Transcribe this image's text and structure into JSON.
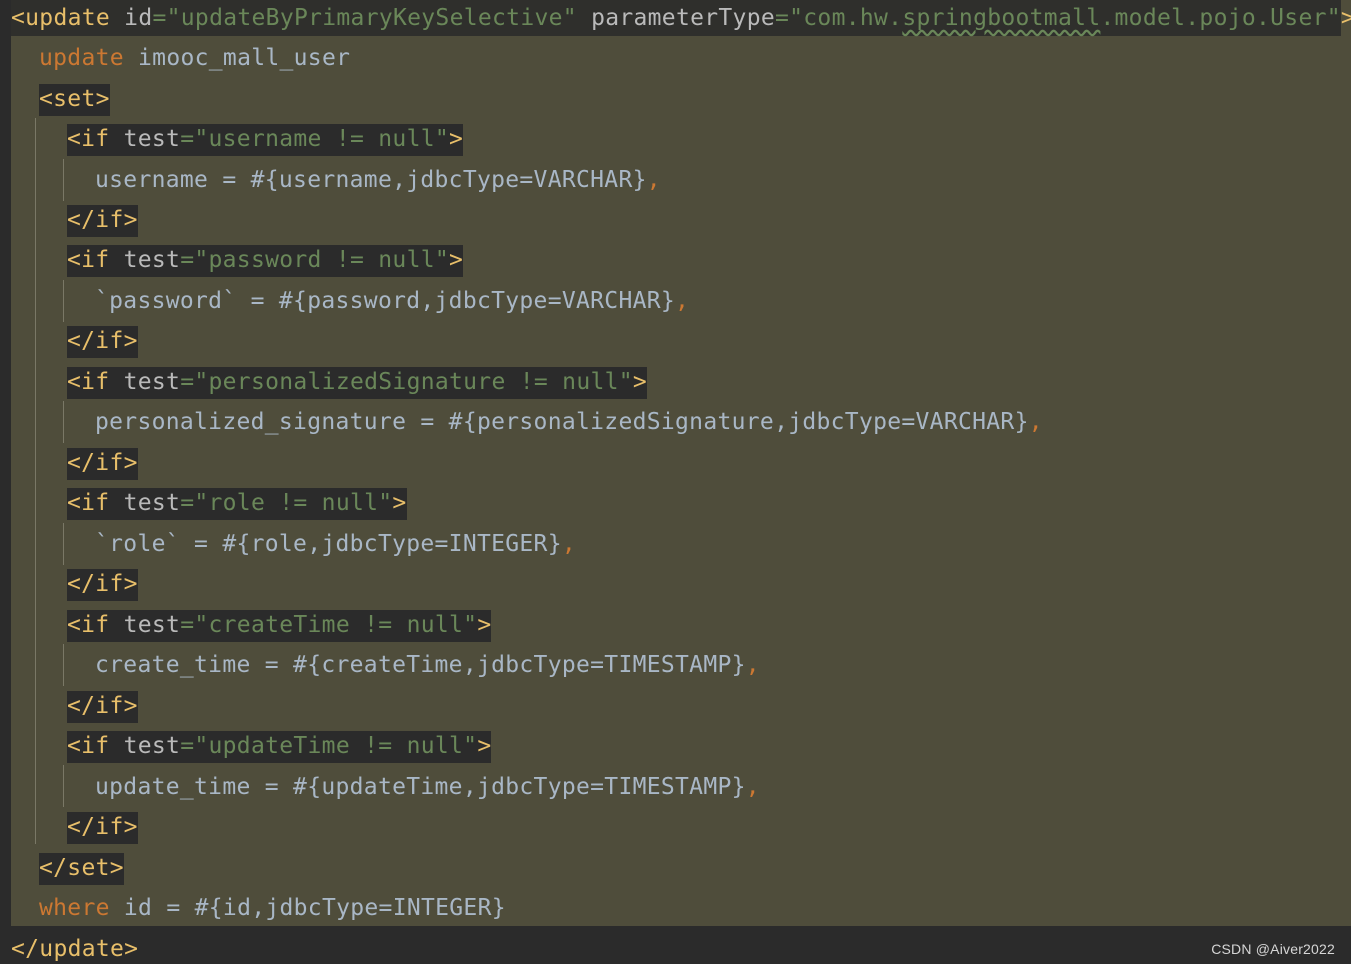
{
  "editor": {
    "theme_colors": {
      "background": "#4f4d3b",
      "tag": "#e8bf6a",
      "keyword": "#cc7832",
      "string": "#6a8759",
      "text": "#a9b7c6"
    },
    "lines": [
      {
        "open": "<update",
        "a1": " id",
        "eq1": "=",
        "v1": "\"updateByPrimaryKeySelective\"",
        "a2": " parameterType",
        "eq2": "=",
        "v2a": "\"com.hw.",
        "v2b": "springbootmall",
        "v2c": ".model.pojo.User\"",
        "close": ">"
      },
      {
        "kw": "update",
        "rest": " imooc_mall_user"
      },
      {
        "tag": "<set>"
      },
      {
        "open": "<if",
        "attr": " test",
        "eq": "=",
        "val": "\"username != null\"",
        "close": ">"
      },
      {
        "text": "username = #{username,jdbcType=VARCHAR}",
        "comma": ","
      },
      {
        "tag": "</if>"
      },
      {
        "open": "<if",
        "attr": " test",
        "eq": "=",
        "val": "\"password != null\"",
        "close": ">"
      },
      {
        "text": "`password` = #{password,jdbcType=VARCHAR}",
        "comma": ","
      },
      {
        "tag": "</if>"
      },
      {
        "open": "<if",
        "attr": " test",
        "eq": "=",
        "val": "\"personalizedSignature != null\"",
        "close": ">"
      },
      {
        "text": "personalized_signature = #{personalizedSignature,jdbcType=VARCHAR}",
        "comma": ","
      },
      {
        "tag": "</if>"
      },
      {
        "open": "<if",
        "attr": " test",
        "eq": "=",
        "val": "\"role != null\"",
        "close": ">"
      },
      {
        "text": "`role` = #{role,jdbcType=INTEGER}",
        "comma": ","
      },
      {
        "tag": "</if>"
      },
      {
        "open": "<if",
        "attr": " test",
        "eq": "=",
        "val": "\"createTime != null\"",
        "close": ">"
      },
      {
        "text": "create_time = #{createTime,jdbcType=TIMESTAMP}",
        "comma": ","
      },
      {
        "tag": "</if>"
      },
      {
        "open": "<if",
        "attr": " test",
        "eq": "=",
        "val": "\"updateTime != null\"",
        "close": ">"
      },
      {
        "text": "update_time = #{updateTime,jdbcType=TIMESTAMP}",
        "comma": ","
      },
      {
        "tag": "</if>"
      },
      {
        "tag": "</set>"
      },
      {
        "kw": "where",
        "rest": " id = #{id,jdbcType=INTEGER}"
      },
      {
        "tag": "</update>"
      }
    ]
  },
  "watermark": "CSDN @Aiver2022"
}
